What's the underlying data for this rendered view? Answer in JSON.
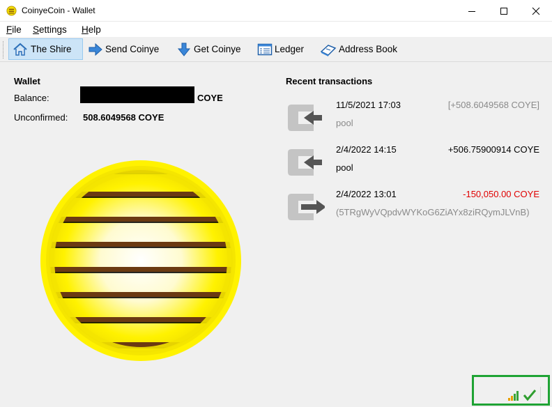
{
  "window": {
    "title": "CoinyeCoin - Wallet"
  },
  "menu": {
    "file": "File",
    "settings": "Settings",
    "help": "Help"
  },
  "toolbar": {
    "the_shire": "The Shire",
    "send": "Send Coinye",
    "get": "Get Coinye",
    "ledger": "Ledger",
    "address_book": "Address Book"
  },
  "wallet": {
    "title": "Wallet",
    "balance_label": "Balance:",
    "balance_unit": "COYE",
    "unconfirmed_label": "Unconfirmed:",
    "unconfirmed_value": "508.6049568 COYE"
  },
  "recent": {
    "title": "Recent transactions",
    "items": [
      {
        "direction": "in",
        "date": "11/5/2021 17:03",
        "amount": "[+508.6049568 COYE]",
        "sub": "pool",
        "state": "unconfirmed"
      },
      {
        "direction": "in",
        "date": "2/4/2022 14:15",
        "amount": "+506.75900914 COYE",
        "sub": "pool",
        "state": "confirmed"
      },
      {
        "direction": "out",
        "date": "2/4/2022 13:01",
        "amount": "-150,050.00 COYE",
        "sub": "(5TRgWyVQpdvWYKoG6ZiAYx8ziRQymJLVnB)",
        "state": "negative"
      }
    ]
  },
  "colors": {
    "selected_tab_bg": "#cce4f7",
    "negative": "#e00000",
    "muted": "#8a8a8a",
    "highlight_box": "#1fa334",
    "coin_yellow": "#fff200"
  },
  "icons": [
    "app-coin-icon",
    "house-icon",
    "send-arrow-icon",
    "get-arrow-icon",
    "ledger-icon",
    "address-book-icon",
    "tx-in-icon",
    "tx-out-icon",
    "signal-icon",
    "sync-check-icon"
  ]
}
